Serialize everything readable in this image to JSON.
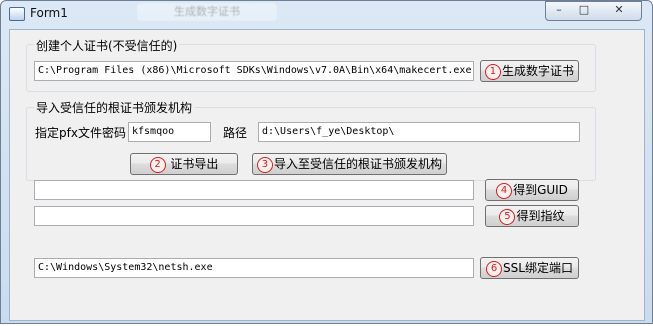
{
  "window": {
    "title": "Form1",
    "ghost_tab": "生成数字证书"
  },
  "group1": {
    "label": "创建个人证书(不受信任的)",
    "makecert_path": "C:\\Program Files (x86)\\Microsoft SDKs\\Windows\\v7.0A\\Bin\\x64\\makecert.exe",
    "button": {
      "number": "1",
      "label": "生成数字证书"
    }
  },
  "group2": {
    "label": "导入受信任的根证书颁发机构",
    "pfx_password_label": "指定pfx文件密码",
    "pfx_password": "kfsmqoo",
    "path_label": "路径",
    "path": "d:\\Users\\f_ye\\Desktop\\",
    "export_button": {
      "number": "2",
      "label": "证书导出"
    },
    "import_button": {
      "number": "3",
      "label": "导入至受信任的根证书颁发机构"
    }
  },
  "guid": {
    "value": "",
    "button": {
      "number": "4",
      "label": "得到GUID"
    }
  },
  "thumbprint": {
    "value": "",
    "button": {
      "number": "5",
      "label": "得到指纹"
    }
  },
  "netsh": {
    "path": "C:\\Windows\\System32\\netsh.exe",
    "button": {
      "number": "6",
      "label": "SSL绑定端口"
    }
  }
}
